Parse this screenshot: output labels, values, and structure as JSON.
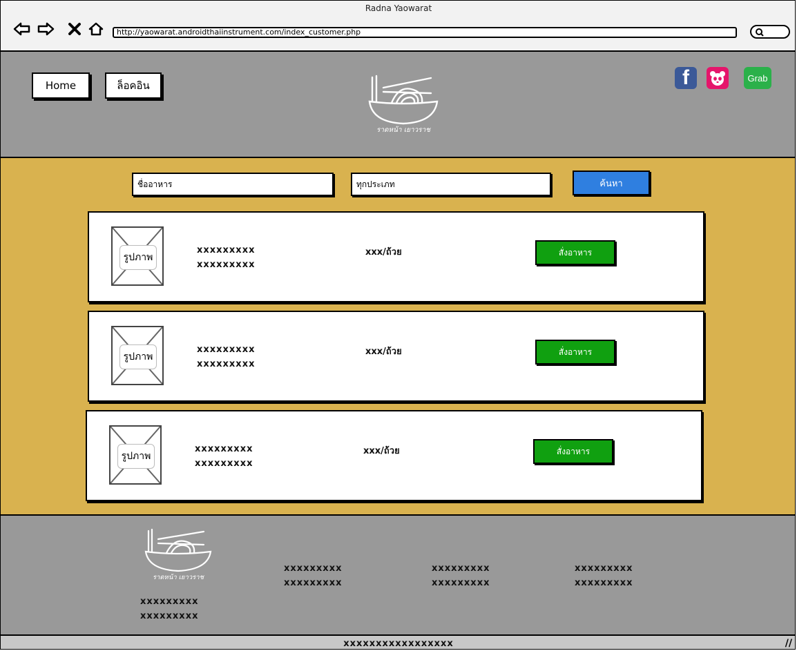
{
  "window": {
    "title": "Radna Yaowarat"
  },
  "browser": {
    "url": "http://yaowarat.androidthaiinstrument.com/index_customer.php",
    "back_icon": "back-arrow-icon",
    "forward_icon": "forward-arrow-icon",
    "close_icon": "close-icon",
    "home_icon": "home-icon",
    "search_icon": "search-icon"
  },
  "header": {
    "home_label": "Home",
    "login_label": "ล็อคอิน",
    "logo_text": "ราดหน้า เยาวราช",
    "social": [
      {
        "name": "facebook",
        "label": "f",
        "color": "#3b5998"
      },
      {
        "name": "foodpanda",
        "label": "",
        "color": "#e5156b"
      },
      {
        "name": "grab",
        "label": "Grab",
        "color": "#2bb14a"
      }
    ]
  },
  "search": {
    "name_value": "ชื่ออาหาร",
    "type_value": "ทุกประเภท",
    "button_label": "ค้นหา"
  },
  "menu_items": [
    {
      "image_label": "รูปภาพ",
      "line1": "xxxxxxxxx",
      "line2": "xxxxxxxxx",
      "price": "xxx/ถ้วย",
      "order_label": "สั่งอาหาร"
    },
    {
      "image_label": "รูปภาพ",
      "line1": "xxxxxxxxx",
      "line2": "xxxxxxxxx",
      "price": "xxx/ถ้วย",
      "order_label": "สั่งอาหาร"
    },
    {
      "image_label": "รูปภาพ",
      "line1": "xxxxxxxxx",
      "line2": "xxxxxxxxx",
      "price": "xxx/ถ้วย",
      "order_label": "สั่งอาหาร"
    }
  ],
  "footer": {
    "logo_text": "ราดหน้า เยาวราช",
    "left": [
      "xxxxxxxxx",
      "xxxxxxxxx"
    ],
    "col1": [
      "xxxxxxxxx",
      "xxxxxxxxx"
    ],
    "col2": [
      "xxxxxxxxx",
      "xxxxxxxxx"
    ],
    "col3": [
      "xxxxxxxxx",
      "xxxxxxxxx"
    ]
  },
  "status_bar": {
    "text": "xxxxxxxxxxxxxxxxx"
  },
  "colors": {
    "header_bg": "#999999",
    "main_bg": "#d9b24f",
    "search_button": "#2f7fe0",
    "order_button": "#10a010"
  }
}
